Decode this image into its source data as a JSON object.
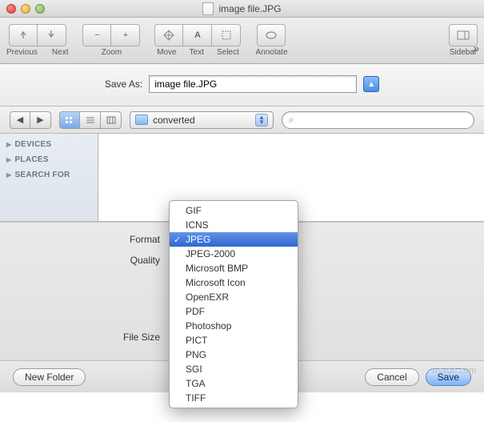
{
  "window": {
    "title": "image file.JPG"
  },
  "toolbar": {
    "previous": "Previous",
    "next": "Next",
    "zoom": "Zoom",
    "move": "Move",
    "text": "Text",
    "select": "Select",
    "annotate": "Annotate",
    "sidebar": "Sidebar"
  },
  "sheet": {
    "saveas_label": "Save As:",
    "saveas_value": "image file.JPG"
  },
  "nav": {
    "path_label": "converted"
  },
  "sidebar": {
    "items": [
      {
        "label": "DEVICES"
      },
      {
        "label": "PLACES"
      },
      {
        "label": "SEARCH FOR"
      }
    ]
  },
  "options": {
    "format_label": "Format",
    "quality_label": "Quality",
    "filesize_label": "File Size"
  },
  "format_menu": {
    "items": [
      "GIF",
      "ICNS",
      "JPEG",
      "JPEG-2000",
      "Microsoft BMP",
      "Microsoft Icon",
      "OpenEXR",
      "PDF",
      "Photoshop",
      "PICT",
      "PNG",
      "SGI",
      "TGA",
      "TIFF"
    ],
    "selected": "JPEG"
  },
  "footer": {
    "newfolder": "New Folder",
    "cancel": "Cancel",
    "save": "Save"
  },
  "watermark": "wsxdn.com"
}
